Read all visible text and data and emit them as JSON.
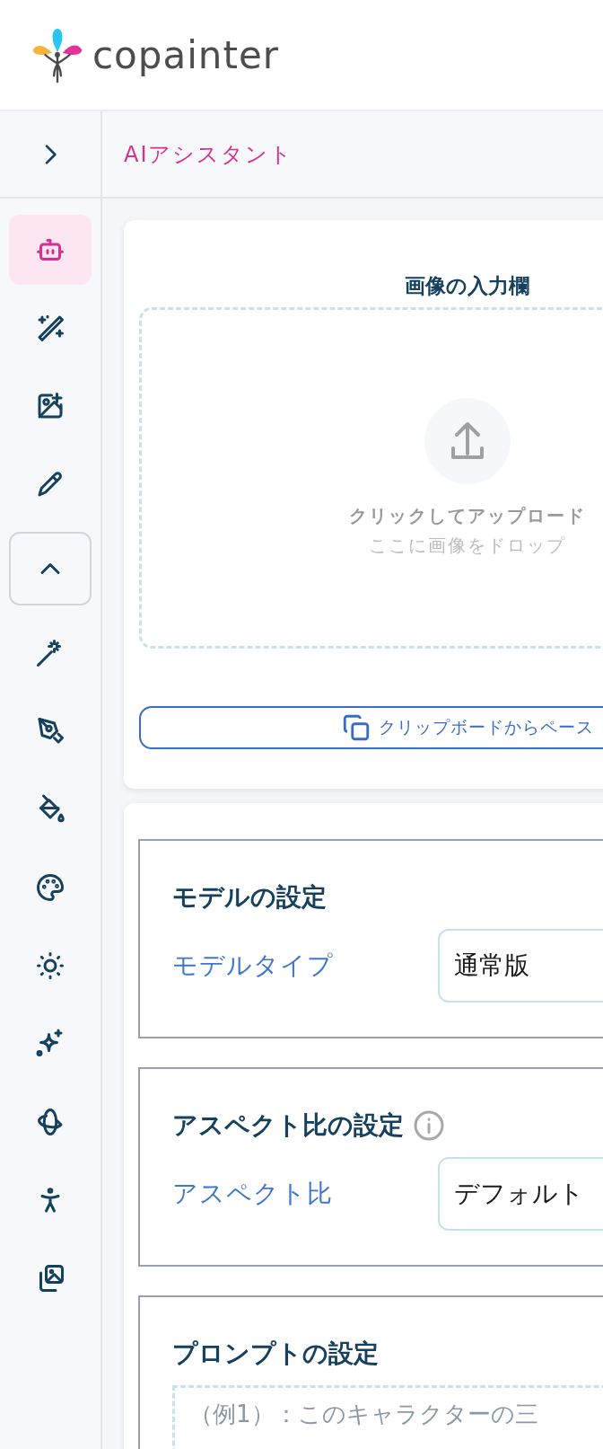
{
  "header": {
    "logo_text": "copainter"
  },
  "sidebar": {
    "expanded": false,
    "group_expanded": true,
    "tools": [
      {
        "selected": true
      },
      {
        "selected": false
      },
      {
        "selected": false
      },
      {
        "selected": false
      }
    ],
    "more_tools": [
      {
        "selected": false
      },
      {
        "selected": false
      },
      {
        "selected": false
      },
      {
        "selected": false
      },
      {
        "selected": false
      },
      {
        "selected": false
      },
      {
        "selected": false
      },
      {
        "selected": false
      },
      {
        "selected": false
      }
    ]
  },
  "page_title": "AIアシスタント",
  "image_input": {
    "title": "画像の入力欄",
    "upload_text": "クリックしてアップロード",
    "drop_text": "ここに画像をドロップ",
    "paste_button": "クリップボードからペース"
  },
  "settings": [
    {
      "kind": "select",
      "title": "モデルの設定",
      "info": false,
      "label": "モデルタイプ",
      "value": "通常版"
    },
    {
      "kind": "select",
      "title": "アスペクト比の設定",
      "info": true,
      "label": "アスペクト比",
      "value": "デフォルト"
    },
    {
      "kind": "prompt",
      "title": "プロンプトの設定",
      "info": false,
      "placeholder": "（例1）：このキャラクターの三"
    }
  ]
}
